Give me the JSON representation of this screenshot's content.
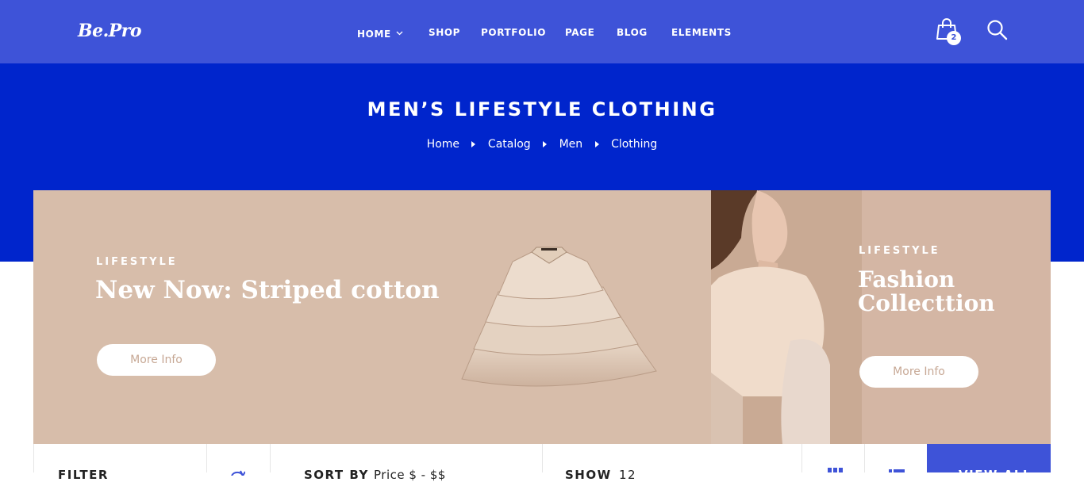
{
  "brand": {
    "logo_text": "Be.Pro"
  },
  "nav": {
    "items": [
      {
        "label": "HOME",
        "has_dropdown": true
      },
      {
        "label": "SHOP"
      },
      {
        "label": "PORTFOLIO"
      },
      {
        "label": "PAGE"
      },
      {
        "label": "BLOG"
      },
      {
        "label": "ELEMENTS"
      }
    ],
    "cart_count": "2"
  },
  "hero": {
    "title": "MEN’S LIFESTYLE CLOTHING",
    "breadcrumbs": [
      "Home",
      "Catalog",
      "Men",
      "Clothing"
    ]
  },
  "banners": [
    {
      "kicker": "LIFESTYLE",
      "title": "New Now: Striped cotton",
      "button": "More Info"
    },
    {
      "kicker": "LIFESTYLE",
      "title_line1": "Fashion",
      "title_line2": "Collecttion",
      "button": "More Info"
    }
  ],
  "toolbar": {
    "filter_label": "FILTER",
    "sort_label": "SORT BY",
    "sort_value": "Price $ - $$",
    "show_label": "SHOW",
    "show_value": "12",
    "view_all_label": "VIEW ALL"
  },
  "colors": {
    "header_bg": "#3e53d8",
    "hero_bg": "#0025cc",
    "banner_bg": "#d7bdaa",
    "accent": "#3e53d8"
  },
  "icons": [
    "chevron-down-icon",
    "shopping-bag-icon",
    "search-icon",
    "refresh-icon",
    "grid-view-icon",
    "list-view-icon"
  ]
}
